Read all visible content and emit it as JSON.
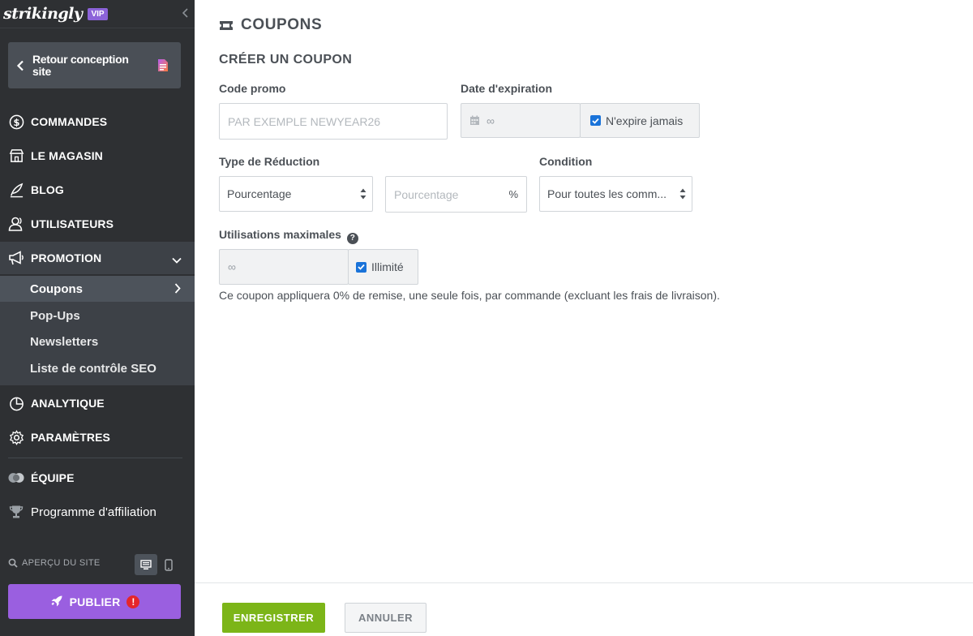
{
  "sidebar": {
    "logo": "strikingly",
    "badge": "VIP",
    "back_label": "Retour conception site",
    "nav": {
      "commandes": "COMMANDES",
      "magasin": "LE MAGASIN",
      "blog": "BLOG",
      "utilisateurs": "UTILISATEURS",
      "promotion": "PROMOTION",
      "analytique": "ANALYTIQUE",
      "parametres": "PARAMÈTRES",
      "equipe": "ÉQUIPE",
      "affiliation": "Programme d'affiliation"
    },
    "promotion_sub": [
      "Coupons",
      "Pop-Ups",
      "Newsletters",
      "Liste de contrôle SEO"
    ],
    "preview_label": "APERÇU DU SITE",
    "publish_label": "PUBLIER",
    "publish_warning": "!"
  },
  "main": {
    "page_title": "COUPONS",
    "section_title": "CRÉER UN COUPON",
    "code_promo": {
      "label": "Code promo",
      "placeholder": "PAR EXEMPLE NEWYEAR26"
    },
    "date_expiration": {
      "label": "Date d'expiration",
      "value": "∞",
      "never_expires_label": "N'expire jamais",
      "never_expires_checked": true
    },
    "type_reduction": {
      "label": "Type de Réduction",
      "selected": "Pourcentage",
      "amount_placeholder": "Pourcentage",
      "unit": "%"
    },
    "condition": {
      "label": "Condition",
      "selected": "Pour toutes les comm..."
    },
    "utilisations": {
      "label": "Utilisations maximales",
      "help": "?",
      "value": "∞",
      "unlimited_label": "Illimité",
      "unlimited_checked": true
    },
    "description": "Ce coupon appliquera 0% de remise, une seule fois, par commande (excluant les frais de livraison)."
  },
  "footer": {
    "save_label": "ENREGISTRER",
    "cancel_label": "ANNULER"
  },
  "colors": {
    "sidebar_bg": "#2e3033",
    "publish_bg": "#9a5fe0",
    "save_bg": "#7cb518",
    "checkbox": "#1a73d9"
  }
}
